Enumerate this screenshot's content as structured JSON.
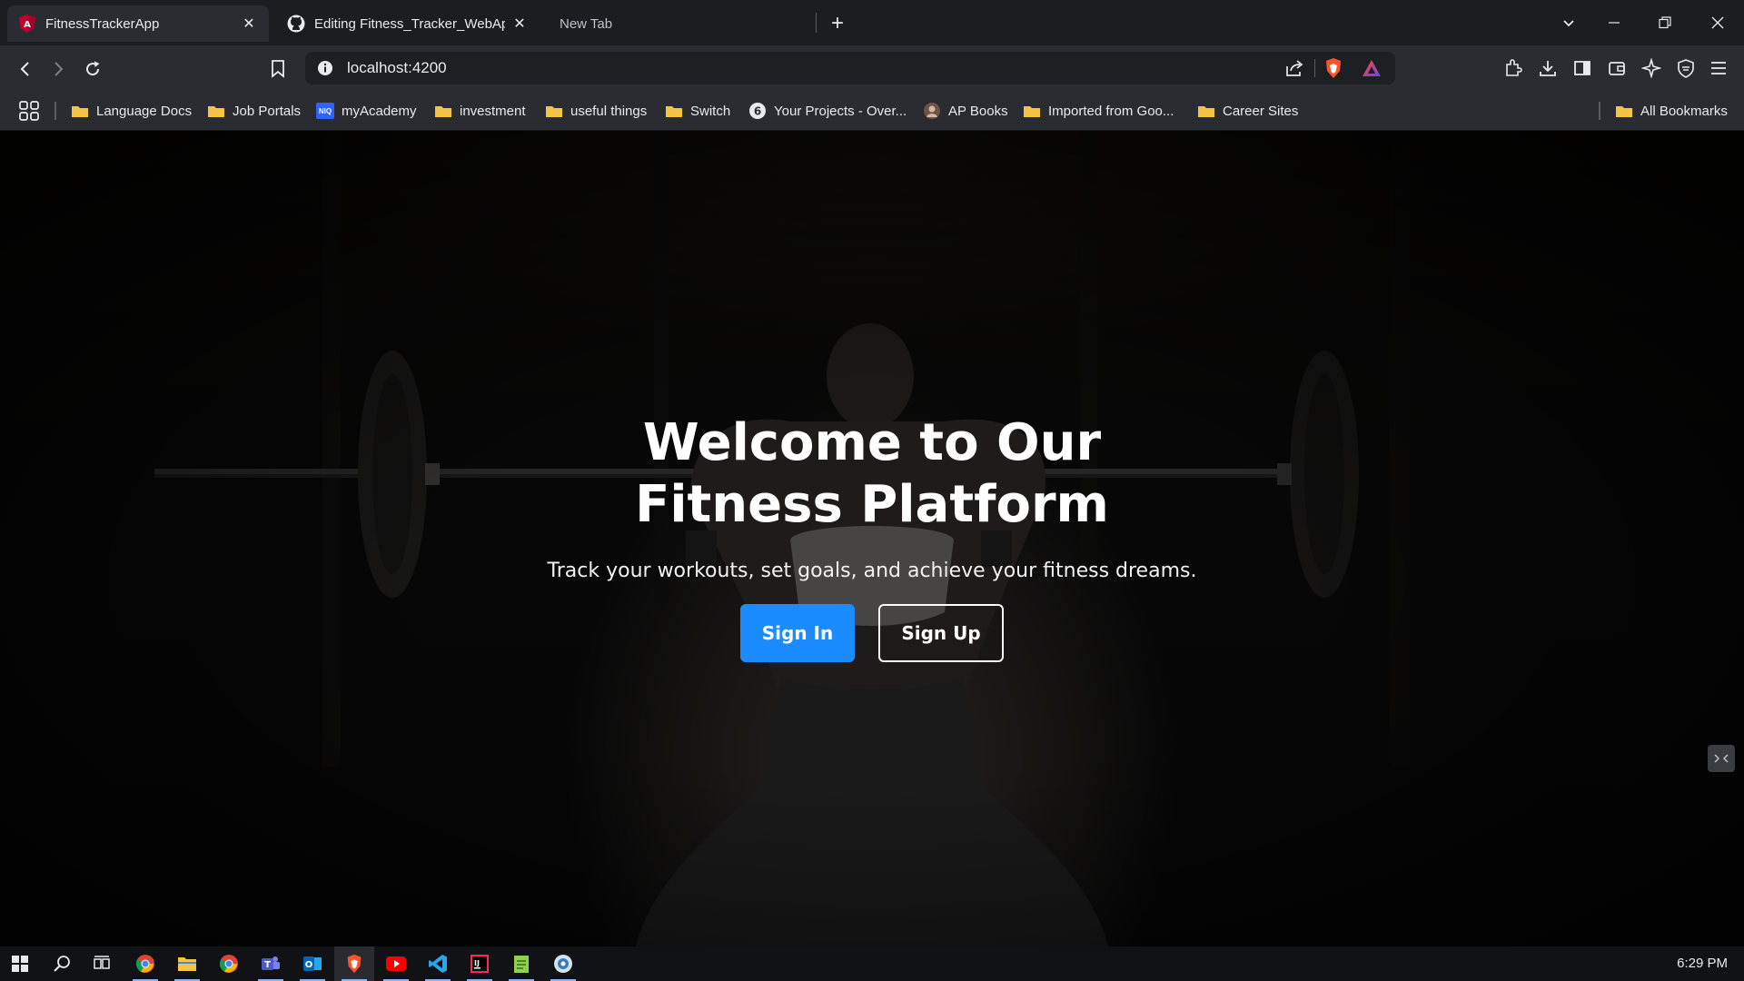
{
  "browser": {
    "tabs": [
      {
        "title": "FitnessTrackerApp",
        "icon": "angular-icon",
        "active": true
      },
      {
        "title": "Editing Fitness_Tracker_WebApp",
        "icon": "github-icon",
        "active": false
      },
      {
        "title": "New Tab",
        "icon": "",
        "active": false
      }
    ],
    "address": "localhost:4200",
    "bookmarks": [
      {
        "label": "Language Docs",
        "icon": "folder-icon"
      },
      {
        "label": "Job Portals",
        "icon": "folder-icon"
      },
      {
        "label": "myAcademy",
        "icon": "niq-icon"
      },
      {
        "label": "investment",
        "icon": "folder-icon"
      },
      {
        "label": "useful things",
        "icon": "folder-icon"
      },
      {
        "label": "Switch",
        "icon": "folder-icon"
      },
      {
        "label": "Your Projects - Over...",
        "icon": "six-icon"
      },
      {
        "label": "AP Books",
        "icon": "avatar-icon"
      },
      {
        "label": "Imported from Goo...",
        "icon": "folder-icon"
      },
      {
        "label": "Career Sites",
        "icon": "folder-icon"
      }
    ],
    "all_bookmarks": "All Bookmarks",
    "niq_badge": "NIQ",
    "accent": "#8ab4f8"
  },
  "page": {
    "hero_title": "Welcome to Our Fitness Platform",
    "hero_subtitle": "Track your workouts, set goals, and achieve your fitness dreams.",
    "signin_label": "Sign In",
    "signup_label": "Sign Up",
    "primary_color": "#1a8cff"
  },
  "taskbar": {
    "clock": "6:29 PM",
    "apps": [
      "start-icon",
      "search-icon",
      "task-view-icon",
      "chrome-icon",
      "file-explorer-icon",
      "chrome-icon",
      "teams-icon",
      "outlook-icon",
      "brave-icon",
      "youtube-icon",
      "vscode-icon",
      "intellij-icon",
      "notepad-icon",
      "app-icon"
    ]
  }
}
